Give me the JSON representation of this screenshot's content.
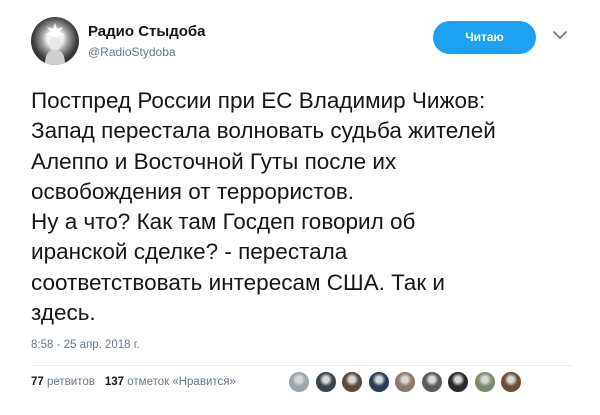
{
  "author": {
    "name": "Радио Стыдоба",
    "handle": "@RadioStydoba"
  },
  "follow_button": {
    "label": "Читаю"
  },
  "tweet": {
    "lines": [
      "Постпред России при ЕС Владимир Чижов:",
      "Запад перестала волновать судьба жителей",
      "Алеппо и Восточной Гуты после их",
      "освобождения от террористов.",
      "Ну а что? Как там Госдеп говорил об",
      "иранской сделке? - перестала",
      "соответствовать интересам США. Так и",
      "здесь."
    ],
    "timestamp": "8:58 - 25 апр. 2018 г."
  },
  "stats": {
    "retweets_count": "77",
    "retweets_label": "ретвитов",
    "likes_count": "137",
    "likes_label": "отметок «Нравится»"
  },
  "likers": [
    {
      "icon": "user-avatar-icon",
      "color": "#9aa4ad"
    },
    {
      "icon": "user-avatar-icon",
      "color": "#3d4148"
    },
    {
      "icon": "user-avatar-icon",
      "color": "#5a4a3f"
    },
    {
      "icon": "user-avatar-icon",
      "color": "#2b3b57"
    },
    {
      "icon": "user-avatar-icon",
      "color": "#8a7a6b"
    },
    {
      "icon": "user-avatar-icon",
      "color": "#5d5a55"
    },
    {
      "icon": "user-avatar-icon",
      "color": "#2a2a2a"
    },
    {
      "icon": "user-avatar-icon",
      "color": "#7b8c6e"
    },
    {
      "icon": "user-avatar-icon",
      "color": "#6b4f3a"
    }
  ],
  "colors": {
    "accent": "#1da1f2",
    "text": "#14171a",
    "muted": "#657786"
  }
}
